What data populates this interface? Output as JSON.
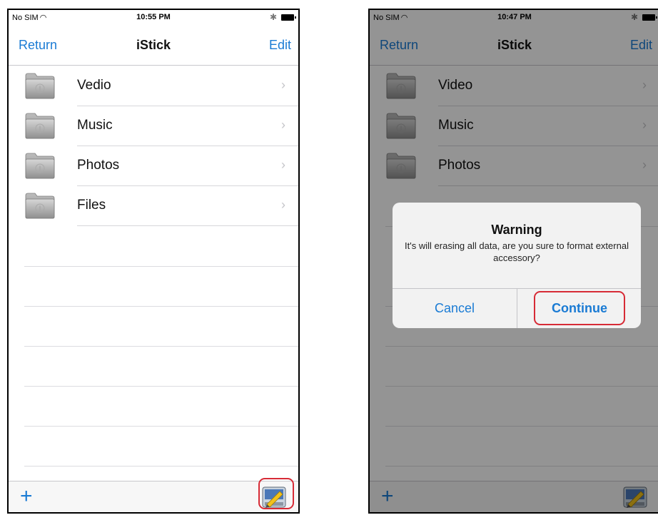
{
  "left_screen": {
    "status": {
      "carrier": "No SIM",
      "time": "10:55 PM"
    },
    "nav": {
      "back_label": "Return",
      "title": "iStick",
      "edit_label": "Edit"
    },
    "rows": [
      {
        "label": "Vedio"
      },
      {
        "label": "Music"
      },
      {
        "label": "Photos"
      },
      {
        "label": "Files"
      }
    ],
    "toolbar": {
      "add_label": "+"
    }
  },
  "right_screen": {
    "status": {
      "carrier": "No SIM",
      "time": "10:47 PM"
    },
    "nav": {
      "back_label": "Return",
      "title": "iStick",
      "edit_label": "Edit"
    },
    "rows": [
      {
        "label": "Video"
      },
      {
        "label": "Music"
      },
      {
        "label": "Photos"
      }
    ],
    "toolbar": {
      "add_label": "+"
    },
    "alert": {
      "title": "Warning",
      "message": "It's will erasing all data, are you sure to format external accessory?",
      "cancel_label": "Cancel",
      "continue_label": "Continue"
    }
  },
  "colors": {
    "accent": "#1a7bd4",
    "highlight": "#d72b36",
    "separator": "#d6d6da"
  },
  "icons": {
    "folder": "folder-icon",
    "chevron": "chevron-right-icon",
    "format": "format-accessory-icon"
  }
}
